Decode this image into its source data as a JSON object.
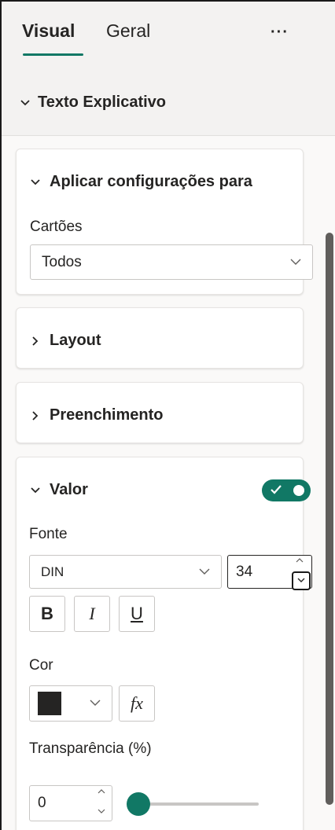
{
  "tabs": {
    "visual": "Visual",
    "geral": "Geral",
    "more": "···"
  },
  "section": {
    "title": "Texto Explicativo"
  },
  "apply_card": {
    "title": "Aplicar configurações para",
    "field_label": "Cartões",
    "selected": "Todos"
  },
  "layout_card": {
    "title": "Layout"
  },
  "fill_card": {
    "title": "Preenchimento"
  },
  "value_card": {
    "title": "Valor",
    "toggle_on": true,
    "font_label": "Fonte",
    "font_family": "DIN",
    "font_size": "34",
    "bold": "B",
    "italic": "I",
    "underline": "U",
    "color_label": "Cor",
    "color_value": "#252423",
    "fx": "fx",
    "transparency_label": "Transparência (%)",
    "transparency_value": "0",
    "transparency_fraction": 0
  },
  "colors": {
    "accent": "#117865",
    "text": "#252423",
    "swatch": "#252423"
  }
}
